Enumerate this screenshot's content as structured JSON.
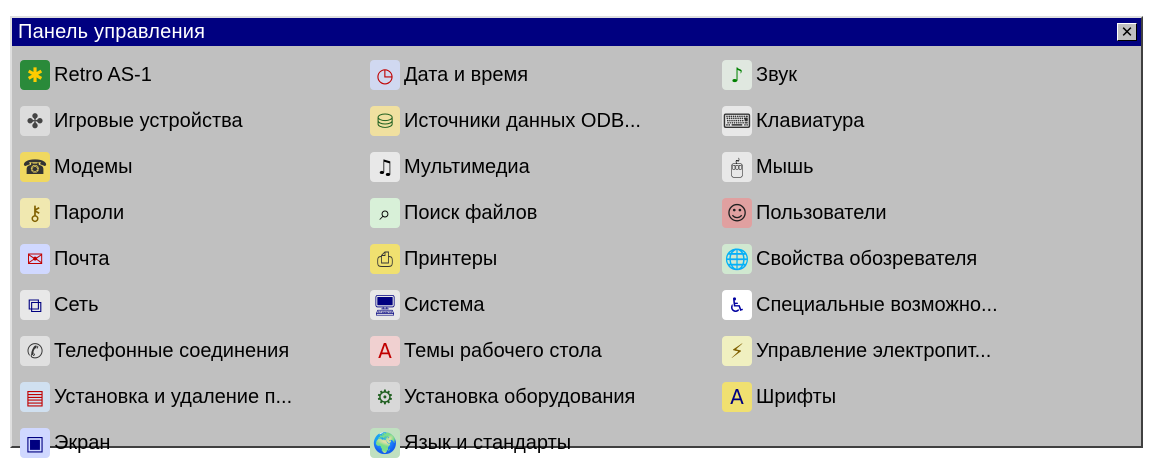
{
  "window": {
    "title": "Панель управления",
    "close_glyph": "✕"
  },
  "items": [
    {
      "label": "Retro AS-1",
      "icon": "game-controller-icon",
      "glyph": "✱",
      "bg": "#2a8a3a",
      "fg": "#ffcc00"
    },
    {
      "label": "Дата и время",
      "icon": "calendar-clock-icon",
      "glyph": "◷",
      "bg": "#d0d8f0",
      "fg": "#c00000"
    },
    {
      "label": "Звук",
      "icon": "speaker-icon",
      "glyph": "♪",
      "bg": "#e0e8e0",
      "fg": "#008000"
    },
    {
      "label": "Игровые устройства",
      "icon": "joystick-icon",
      "glyph": "✤",
      "bg": "#dcdcdc",
      "fg": "#444444"
    },
    {
      "label": "Источники данных ODB...",
      "icon": "database-icon",
      "glyph": "⛁",
      "bg": "#f0e0a0",
      "fg": "#206020"
    },
    {
      "label": "Клавиатура",
      "icon": "keyboard-icon",
      "glyph": "⌨",
      "bg": "#e8e8e8",
      "fg": "#333333"
    },
    {
      "label": "Модемы",
      "icon": "modem-icon",
      "glyph": "☎",
      "bg": "#f0d860",
      "fg": "#333333"
    },
    {
      "label": "Мультимедиа",
      "icon": "multimedia-icon",
      "glyph": "♫",
      "bg": "#e8e8e8",
      "fg": "#000000"
    },
    {
      "label": "Мышь",
      "icon": "mouse-icon",
      "glyph": "🖱",
      "bg": "#e8e8e8",
      "fg": "#000000"
    },
    {
      "label": "Пароли",
      "icon": "keys-icon",
      "glyph": "⚷",
      "bg": "#f0e8b0",
      "fg": "#806000"
    },
    {
      "label": "Поиск файлов",
      "icon": "find-files-icon",
      "glyph": "⌕",
      "bg": "#d8f0d8",
      "fg": "#000000"
    },
    {
      "label": "Пользователи",
      "icon": "users-icon",
      "glyph": "☺",
      "bg": "#e0a0a0",
      "fg": "#202020"
    },
    {
      "label": "Почта",
      "icon": "mail-icon",
      "glyph": "✉",
      "bg": "#d0d8ff",
      "fg": "#c00000"
    },
    {
      "label": "Принтеры",
      "icon": "printers-folder-icon",
      "glyph": "⎙",
      "bg": "#f0e070",
      "fg": "#333333"
    },
    {
      "label": "Свойства обозревателя",
      "icon": "internet-options-icon",
      "glyph": "🌐",
      "bg": "#d0e8d0",
      "fg": "#006000"
    },
    {
      "label": "Сеть",
      "icon": "network-icon",
      "glyph": "⧉",
      "bg": "#e8e8e8",
      "fg": "#000080"
    },
    {
      "label": "Система",
      "icon": "computer-icon",
      "glyph": "🖥",
      "bg": "#e8e8e8",
      "fg": "#000080"
    },
    {
      "label": "Специальные возможно...",
      "icon": "accessibility-icon",
      "glyph": "♿",
      "bg": "#ffffff",
      "fg": "#0000a0"
    },
    {
      "label": "Телефонные соединения",
      "icon": "telephony-icon",
      "glyph": "✆",
      "bg": "#e0e0e0",
      "fg": "#333333"
    },
    {
      "label": "Темы рабочего стола",
      "icon": "desktop-themes-icon",
      "glyph": "A",
      "bg": "#f0d0d0",
      "fg": "#c00000"
    },
    {
      "label": "Управление электропит...",
      "icon": "power-management-icon",
      "glyph": "⚡",
      "bg": "#f0f0c0",
      "fg": "#806000"
    },
    {
      "label": "Установка и удаление п...",
      "icon": "add-remove-programs-icon",
      "glyph": "▤",
      "bg": "#d0e0f0",
      "fg": "#c00000"
    },
    {
      "label": "Установка оборудования",
      "icon": "add-hardware-icon",
      "glyph": "⚙",
      "bg": "#d8d8d8",
      "fg": "#206020"
    },
    {
      "label": "Шрифты",
      "icon": "fonts-folder-icon",
      "glyph": "A",
      "bg": "#f0e070",
      "fg": "#000080"
    },
    {
      "label": "Экран",
      "icon": "display-icon",
      "glyph": "▣",
      "bg": "#d0d8ff",
      "fg": "#000080"
    },
    {
      "label": "Язык и стандарты",
      "icon": "globe-icon",
      "glyph": "🌍",
      "bg": "#c0e0c0",
      "fg": "#004080"
    }
  ]
}
